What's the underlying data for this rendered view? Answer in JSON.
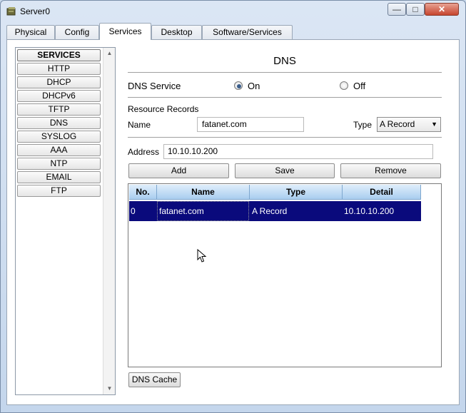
{
  "window": {
    "title": "Server0"
  },
  "tabs": [
    {
      "label": "Physical"
    },
    {
      "label": "Config"
    },
    {
      "label": "Services"
    },
    {
      "label": "Desktop"
    },
    {
      "label": "Software/Services"
    }
  ],
  "sidebar": {
    "header": "SERVICES",
    "items": [
      "HTTP",
      "DHCP",
      "DHCPv6",
      "TFTP",
      "DNS",
      "SYSLOG",
      "AAA",
      "NTP",
      "EMAIL",
      "FTP"
    ]
  },
  "dns": {
    "title": "DNS",
    "service_label": "DNS Service",
    "on_label": "On",
    "off_label": "Off",
    "service_state": "On",
    "resource_records_label": "Resource Records",
    "name_label": "Name",
    "name_value": "fatanet.com",
    "type_label": "Type",
    "type_value": "A Record",
    "address_label": "Address",
    "address_value": "10.10.10.200",
    "add_label": "Add",
    "save_label": "Save",
    "remove_label": "Remove",
    "dns_cache_label": "DNS Cache"
  },
  "table": {
    "headers": [
      "No.",
      "Name",
      "Type",
      "Detail"
    ],
    "rows": [
      {
        "no": "0",
        "name": "fatanet.com",
        "type": "A Record",
        "detail": "10.10.10.200"
      }
    ]
  },
  "colors": {
    "selected_row": "#0a0a7c",
    "header_blue": "#a9cdef"
  }
}
